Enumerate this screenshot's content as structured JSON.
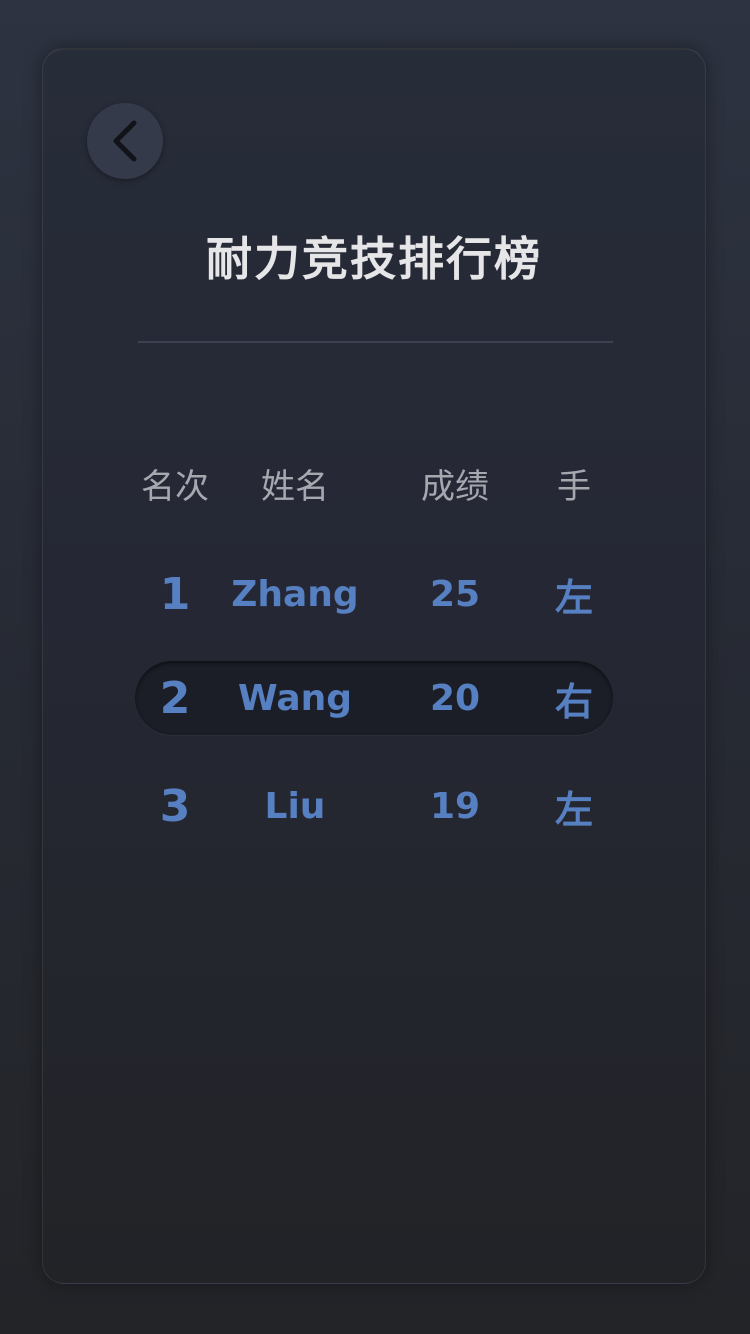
{
  "title": "耐力竞技排行榜",
  "back_icon": "chevron-left-icon",
  "colors": {
    "accent": "#5680c2",
    "header_text": "#a6a8b0",
    "title_text": "#e6e6e8",
    "highlight_row": "#1b1e27"
  },
  "leaderboard": {
    "headers": {
      "rank": "名次",
      "name": "姓名",
      "score": "成绩",
      "hand": "手"
    },
    "rows": [
      {
        "rank": "1",
        "name": "Zhang",
        "score": "25",
        "hand": "左"
      },
      {
        "rank": "2",
        "name": "Wang",
        "score": "20",
        "hand": "右"
      },
      {
        "rank": "3",
        "name": "Liu",
        "score": "19",
        "hand": "左"
      }
    ]
  }
}
